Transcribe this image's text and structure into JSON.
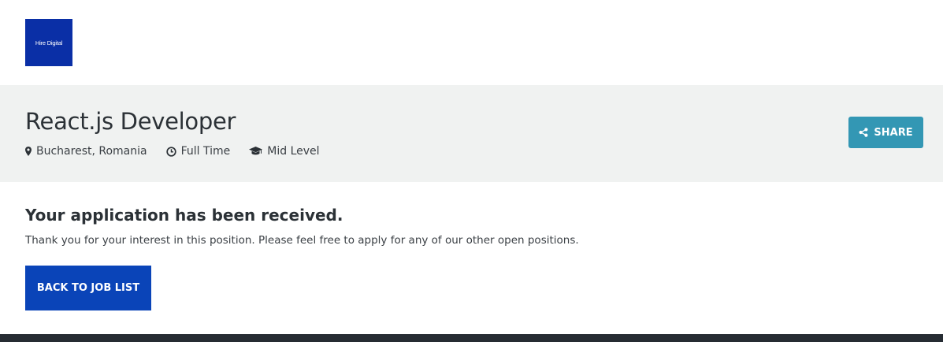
{
  "logo": {
    "text": "Hire Digital",
    "color": "#0a2fa6"
  },
  "job": {
    "title": "React.js Developer",
    "meta": [
      {
        "icon": "location-pin-icon",
        "label": "Bucharest, Romania"
      },
      {
        "icon": "clock-icon",
        "label": "Full Time"
      },
      {
        "icon": "graduation-cap-icon",
        "label": "Mid Level"
      }
    ],
    "share_label": "SHARE",
    "share_icon": "share-icon",
    "share_color": "#3397b4"
  },
  "confirmation": {
    "heading": "Your application has been received.",
    "message": "Thank you for your interest in this position. Please feel free to apply for any of our other open positions.",
    "back_label": "BACK TO JOB LIST",
    "back_color": "#0a44b8"
  }
}
